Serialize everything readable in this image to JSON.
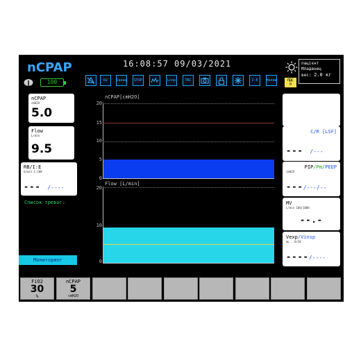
{
  "header": {
    "mode_title": "nCPAP",
    "battery": "100",
    "clock": "16:08:57  09/03/2021",
    "toolbar": [
      {
        "name": "alarm-bell-icon",
        "label": ""
      },
      {
        "name": "o2-button",
        "label": "O2"
      },
      {
        "name": "suction-button",
        "label": "Санац"
      },
      {
        "name": "stop-button",
        "label": "STOP"
      },
      {
        "name": "trend-icon",
        "label": ""
      },
      {
        "name": "loop-button",
        "label": "Loop"
      },
      {
        "name": "trc-button",
        "label": "TRC"
      },
      {
        "name": "camera-icon",
        "label": ""
      },
      {
        "name": "lock-icon",
        "label": ""
      },
      {
        "name": "nebulizer-icon",
        "label": ""
      },
      {
        "name": "iv-button",
        "label": "I:E"
      },
      {
        "name": "settings-button",
        "label": "Налаш"
      }
    ],
    "patient": {
      "title": "пацієнт",
      "type": "Младенец",
      "weight_label": "вес:",
      "weight_value": "2.0 кг"
    },
    "pdc_badge": {
      "line1": "ПДС",
      "line2": "0"
    }
  },
  "left_panels": {
    "ncpap": {
      "label": "nCPAP",
      "unit": "cmH2O",
      "value": "5.0"
    },
    "flow": {
      "label": "Flow",
      "unit": "L/min",
      "value": "9.5"
    },
    "rb": {
      "label": "RB/I:E",
      "unit1": "b/min",
      "unit2": "1:100",
      "value1": "---",
      "value2": "/----"
    },
    "alarm_list": "Список тревог:",
    "monitoring_button": "Мониторинг"
  },
  "waveforms": {
    "pressure": {
      "title": "nCPAP[cmH2O]",
      "ticks": [
        "20",
        "15",
        "10",
        "5",
        "0"
      ],
      "level": 5,
      "ymax": 20
    },
    "flow": {
      "title": "Flow [L/min]",
      "ticks": [
        "20",
        "10",
        "0"
      ],
      "level": 9.5,
      "ymax": 20
    }
  },
  "right_panels": {
    "cr": {
      "label": "C/R [LSF]",
      "value1": "---",
      "value2": "/---"
    },
    "pip": {
      "label_pip": "PIP",
      "label_pm": "/Pm/",
      "label_peep": "PEEP",
      "unit": "cmH2O",
      "value1": "---",
      "value2": "/---/--"
    },
    "mv": {
      "label": "MV",
      "unit": "L/min  100/1000",
      "value": "--.-"
    },
    "vexp": {
      "label_vexp": "Vexp",
      "label_vinsp": "/Vinsp",
      "unit1": "mL",
      "unit2": "0/20",
      "value1": "----",
      "value2": "/----"
    }
  },
  "bottom_bar": {
    "fio2": {
      "label": "FiO2",
      "value": "30",
      "unit": "%"
    },
    "ncpap": {
      "label": "nCPAP",
      "value": "5",
      "unit": "cmH2O"
    }
  }
}
